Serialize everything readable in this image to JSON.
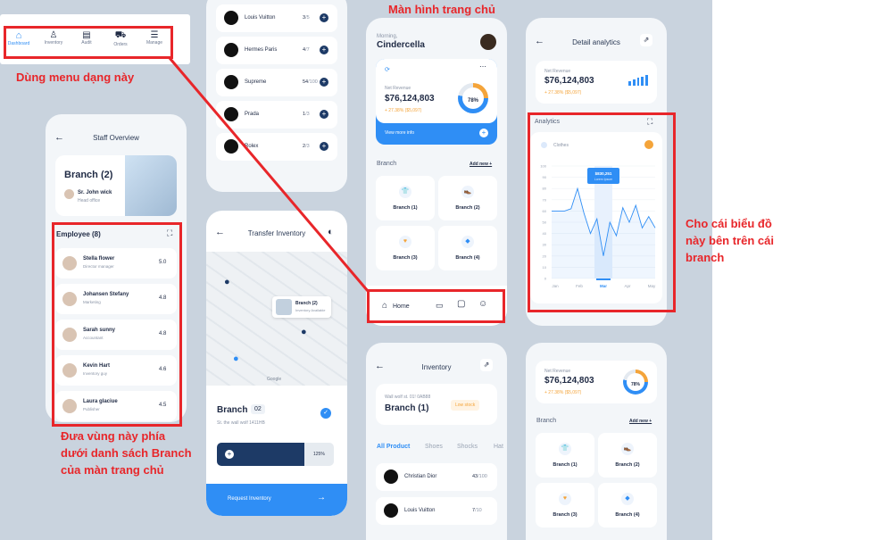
{
  "bottom_menu": {
    "items": [
      "Dashboard",
      "Inventory",
      "Audit",
      "Orders",
      "Manage"
    ]
  },
  "notes": {
    "menu": "Dùng menu dạng này",
    "home_title": "Màn hình trang chủ",
    "chart": "Cho cái biểu đồ này bên trên cái branch",
    "employee": "Đưa vùng này phía dưới danh sách Branch của màn trang chủ"
  },
  "staff": {
    "title": "Staff Overview",
    "branch_title": "Branch (2)",
    "manager_name": "Sr. John wick",
    "manager_role": "Head office",
    "employee_title": "Employee (8)",
    "employees": [
      {
        "name": "Stella flower",
        "role": "Director manager",
        "score": "5.0"
      },
      {
        "name": "Johansen Stefany",
        "role": "Marketing",
        "score": "4.8"
      },
      {
        "name": "Sarah sunny",
        "role": "Accountant",
        "score": "4.8"
      },
      {
        "name": "Kevin Hart",
        "role": "Inventory guy",
        "score": "4.6"
      },
      {
        "name": "Laura glaciue",
        "role": "Publisher",
        "score": "4.5"
      }
    ]
  },
  "brands_top": [
    {
      "name": "Louis Vuitton",
      "count": "3",
      "total": "/5"
    },
    {
      "name": "Hermes Paris",
      "count": "4",
      "total": "/7"
    },
    {
      "name": "Supreme",
      "count": "54",
      "total": "/100"
    },
    {
      "name": "Prada",
      "count": "1",
      "total": "/3"
    },
    {
      "name": "Rolex",
      "count": "2",
      "total": "/3"
    }
  ],
  "transfer": {
    "title": "Transfer Inventory",
    "popup_title": "Branch (2)",
    "popup_sub": "Inventory Available",
    "map_credit": "Google",
    "branch_label": "Branch",
    "branch_num": "02",
    "address": "St. the wall wolf 1411HB",
    "percent": "125%",
    "request": "Request Inventory"
  },
  "home": {
    "greeting": "Morning,",
    "name": "Cindercella",
    "net_label": "Net Revenue",
    "net_value": "$76,124,803",
    "change": "+ 27.38% ($5,097)",
    "ring": "78%",
    "view_more": "View more info",
    "branch_title": "Branch",
    "add_new": "Add new +",
    "branches": [
      "Branch (1)",
      "Branch (2)",
      "Branch (3)",
      "Branch (4)"
    ],
    "nav_home": "Home"
  },
  "analytics": {
    "title": "Detail analytics",
    "net_label": "Net Revenue",
    "net_value": "$76,124,803",
    "change": "+ 27.38% ($5,097)",
    "section": "Analytics",
    "category": "Clothes",
    "tooltip_value": "$830,251",
    "tooltip_sub": "Lorem Ipsum"
  },
  "chart_data": {
    "type": "line",
    "x": [
      "Jan",
      "Feb",
      "Mar",
      "Apr",
      "May"
    ],
    "yticks": [
      "100",
      "90",
      "80",
      "70",
      "60",
      "50",
      "40",
      "30",
      "20",
      "10",
      "0"
    ],
    "values": [
      60,
      60,
      60,
      62,
      80,
      58,
      40,
      53,
      20,
      50,
      38,
      63,
      50,
      65,
      45,
      55,
      45
    ],
    "ylim": [
      0,
      100
    ],
    "highlight": "Mar",
    "grid": true
  },
  "inventory": {
    "title": "Inventory",
    "address": "Wall wolf st. 01! 0AB88",
    "branch": "Branch (1)",
    "badge": "Low stock",
    "tabs": [
      "All Product",
      "Shoes",
      "Shocks",
      "Hat"
    ],
    "items": [
      {
        "name": "Christian Dior",
        "count": "43",
        "total": "/100"
      },
      {
        "name": "Louis Vuitton",
        "count": "7",
        "total": "/10"
      }
    ]
  },
  "home2": {
    "net_label": "Net Revenue",
    "net_value": "$76,124,803",
    "change": "+ 27.38% ($5,097)",
    "ring": "78%",
    "branch_title": "Branch",
    "add_new": "Add new +",
    "branches": [
      "Branch (1)",
      "Branch (2)",
      "Branch (3)",
      "Branch (4)"
    ]
  }
}
